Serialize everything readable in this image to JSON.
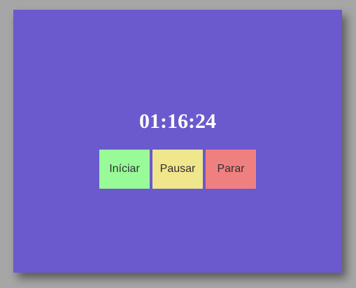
{
  "stopwatch": {
    "time": "01:16:24",
    "buttons": {
      "start_label": "Iníciar",
      "pause_label": "Pausar",
      "stop_label": "Parar"
    }
  },
  "colors": {
    "panel_background": "#6a5acd",
    "page_background": "#a6a6a6",
    "start_button": "#98fb98",
    "pause_button": "#f0e68c",
    "stop_button": "#f08080",
    "time_text": "#ffffff"
  }
}
